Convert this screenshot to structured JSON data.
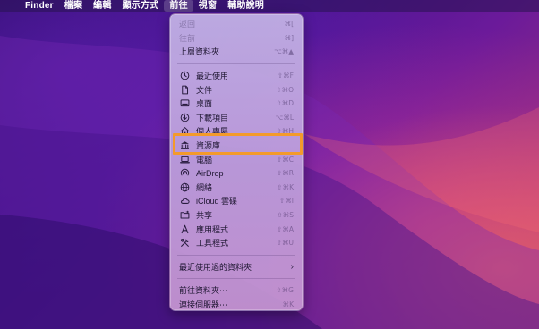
{
  "menubar": {
    "apple": "",
    "items": [
      "Finder",
      "檔案",
      "編輯",
      "顯示方式",
      "前往",
      "視窗",
      "輔助說明"
    ],
    "active_index": 4
  },
  "menu": {
    "back": {
      "label": "返回",
      "shortcut": "⌘["
    },
    "forward": {
      "label": "往前",
      "shortcut": "⌘]"
    },
    "enclosing": {
      "label": "上層資料夾",
      "shortcut": "⌥⌘▲"
    },
    "items": [
      {
        "icon": "clock-icon",
        "label": "最近使用",
        "shortcut": "⇧⌘F"
      },
      {
        "icon": "document-icon",
        "label": "文件",
        "shortcut": "⇧⌘O"
      },
      {
        "icon": "desktop-icon",
        "label": "桌面",
        "shortcut": "⇧⌘D"
      },
      {
        "icon": "download-icon",
        "label": "下載項目",
        "shortcut": "⌥⌘L"
      },
      {
        "icon": "home-icon",
        "label": "個人專屬",
        "shortcut": "⇧⌘H"
      },
      {
        "icon": "library-icon",
        "label": "資源庫",
        "shortcut": ""
      },
      {
        "icon": "laptop-icon",
        "label": "電腦",
        "shortcut": "⇧⌘C"
      },
      {
        "icon": "airdrop-icon",
        "label": "AirDrop",
        "shortcut": "⇧⌘R"
      },
      {
        "icon": "network-icon",
        "label": "網絡",
        "shortcut": "⇧⌘K"
      },
      {
        "icon": "cloud-icon",
        "label": "iCloud 雲碟",
        "shortcut": "⇧⌘I"
      },
      {
        "icon": "shared-folder-icon",
        "label": "共享",
        "shortcut": "⇧⌘S"
      },
      {
        "icon": "applications-icon",
        "label": "應用程式",
        "shortcut": "⇧⌘A"
      },
      {
        "icon": "utilities-icon",
        "label": "工具程式",
        "shortcut": "⇧⌘U"
      }
    ],
    "recent_folders": {
      "label": "最近使用過的資料夾",
      "chevron": "›"
    },
    "goto_folder": {
      "label": "前往資料夾⋯",
      "shortcut": "⇧⌘G"
    },
    "connect_server": {
      "label": "連接伺服器⋯",
      "shortcut": "⌘K"
    }
  },
  "colors": {
    "highlight_border": "#f39a2b",
    "menu_bg": "#c8b4e6",
    "wallpaper_primary": "#4a1493"
  }
}
